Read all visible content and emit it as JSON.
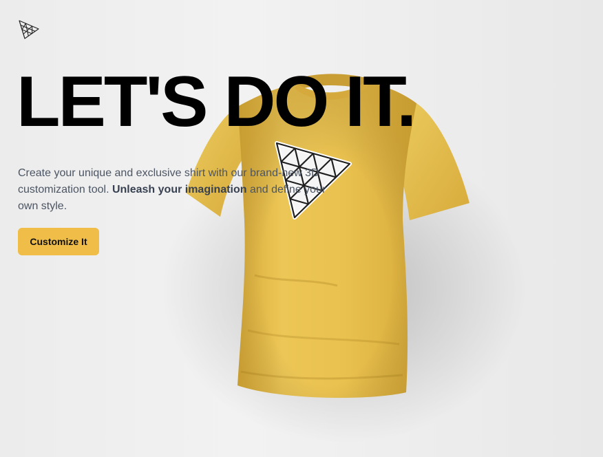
{
  "hero": {
    "headline": "LET'S DO IT.",
    "description_before": "Create your unique and exclusive shirt with our brand-new 3D customization tool. ",
    "description_bold": "Unleash your imagination",
    "description_after": " and define your own style.",
    "cta_label": "Customize It"
  },
  "icons": {
    "logo": "triangle-grid-logo-icon",
    "shirt_decal": "triangle-grid-decal"
  },
  "colors": {
    "accent": "#efbd48",
    "shirt": "#e9c14f",
    "headline": "#000000",
    "text": "#4b5563",
    "background": "#ececec"
  }
}
